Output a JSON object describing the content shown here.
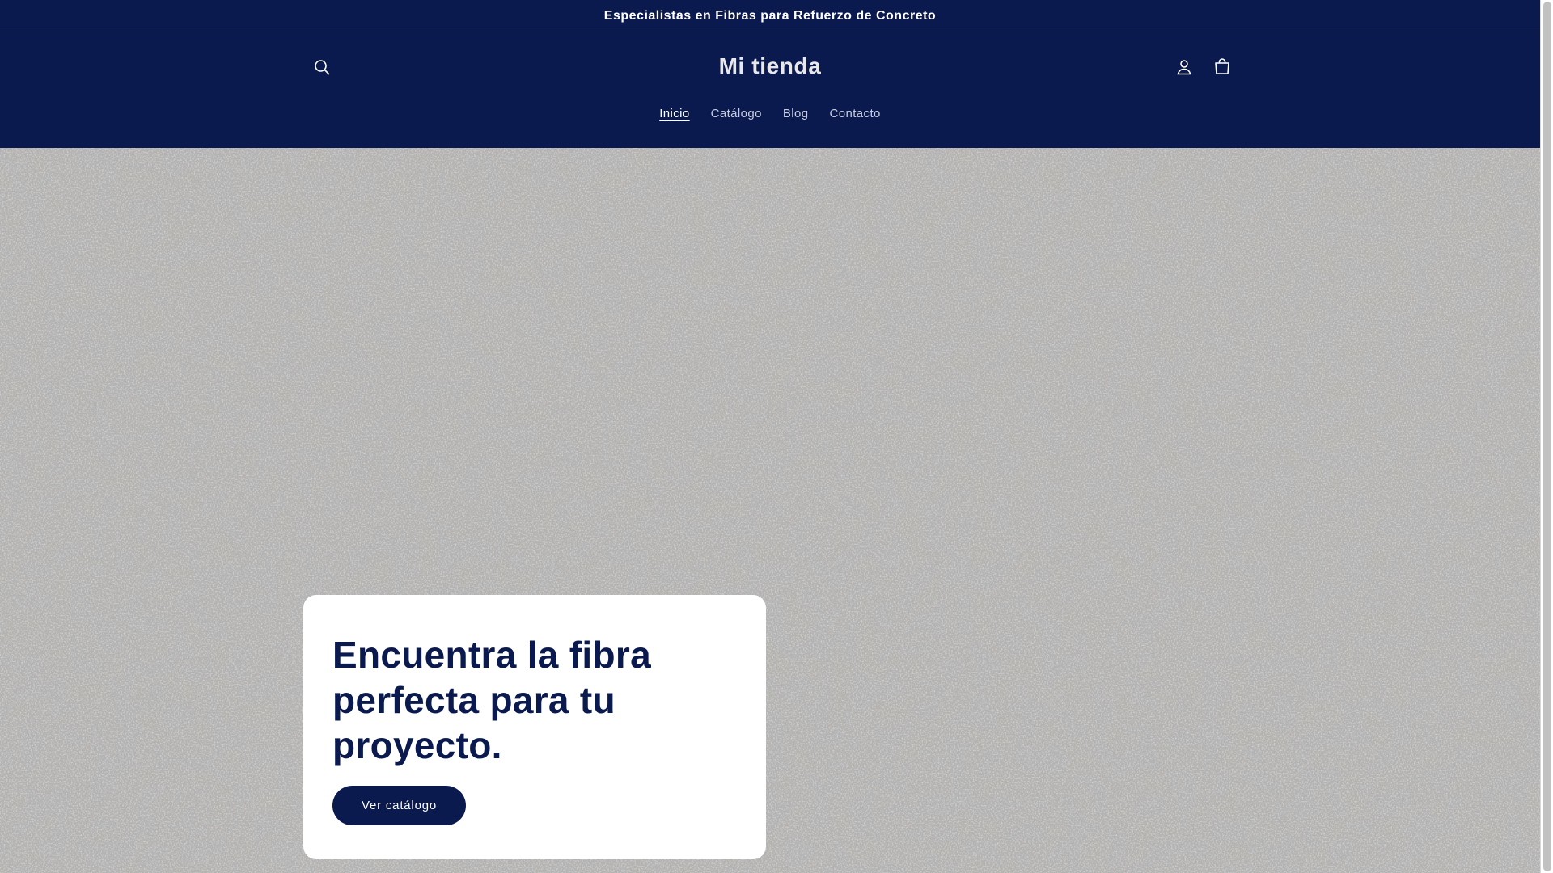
{
  "announcement": {
    "text": "Especialistas en Fibras para Refuerzo de Concreto"
  },
  "header": {
    "logo": "Mi tienda",
    "icons": {
      "search": "search-icon",
      "account": "user-icon",
      "cart": "cart-icon"
    }
  },
  "nav": {
    "items": [
      {
        "label": "Inicio",
        "active": true
      },
      {
        "label": "Catálogo",
        "active": false
      },
      {
        "label": "Blog",
        "active": false
      },
      {
        "label": "Contacto",
        "active": false
      }
    ]
  },
  "hero": {
    "title": "Encuentra la fibra perfecta para tu proyecto.",
    "button_label": "Ver catálogo"
  },
  "colors": {
    "brand": "#0b1a4e",
    "card": "#ffffff",
    "nav_text": "#c8cde0"
  }
}
